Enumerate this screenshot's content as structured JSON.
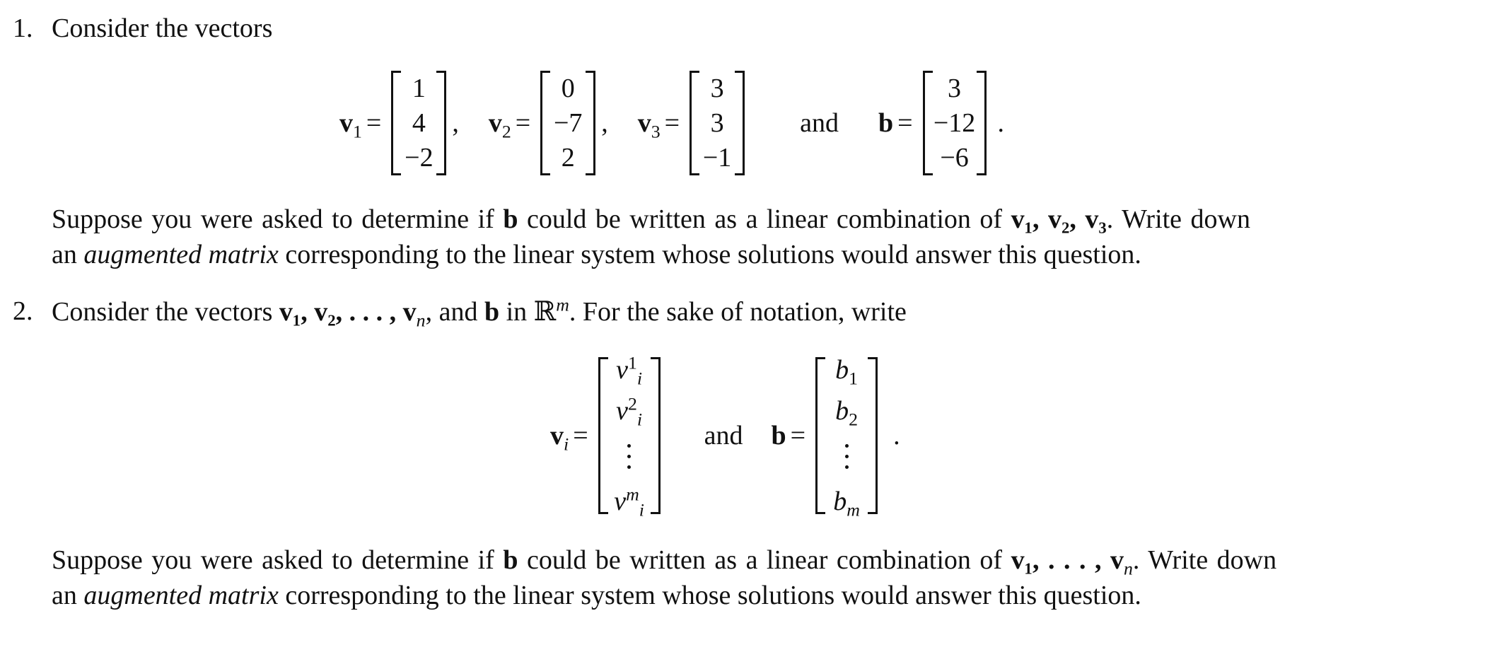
{
  "problem1": {
    "number": "1.",
    "intro": "Consider the vectors",
    "vectors": [
      {
        "name": "v",
        "sub": "1",
        "entries": [
          "1",
          "4",
          "−2"
        ],
        "trail": ","
      },
      {
        "name": "v",
        "sub": "2",
        "entries": [
          "0",
          "−7",
          "2"
        ],
        "trail": ","
      },
      {
        "name": "v",
        "sub": "3",
        "entries": [
          "3",
          "3",
          "−1"
        ],
        "trail": ""
      },
      {
        "name": "b",
        "sub": "",
        "entries": [
          "3",
          "−12",
          "−6"
        ],
        "trail": "."
      }
    ],
    "and": "and",
    "eq": "=",
    "para_line1_a": "Suppose you were asked to determine if ",
    "para_b": "b",
    "para_line1_b": " could be written as a linear combination of ",
    "para_vlist": "v₁, v₂, v₃",
    "para_line1_c": ". Write down",
    "para_line2_a": "an ",
    "para_line2_em": "augmented matrix",
    "para_line2_b": " corresponding to the linear system whose solutions would answer this question."
  },
  "problem2": {
    "number": "2.",
    "intro_a": "Consider the vectors ",
    "intro_vlist": "v₁, v₂, . . . , v",
    "intro_vsub": "n",
    "intro_b": ", and ",
    "intro_bvec": "b",
    "intro_c": " in ℝ",
    "intro_sup": "m",
    "intro_d": ". For the sake of notation, write",
    "vi_name": "v",
    "vi_sub": "i",
    "vi_entries": [
      {
        "base": "v",
        "sup": "1",
        "sub": "i"
      },
      {
        "base": "v",
        "sup": "2",
        "sub": "i"
      },
      {
        "base": "v",
        "sup": "m",
        "sub": "i"
      }
    ],
    "b_name": "b",
    "b_entries": [
      {
        "base": "b",
        "sub": "1"
      },
      {
        "base": "b",
        "sub": "2"
      },
      {
        "base": "b",
        "sub": "m"
      }
    ],
    "and": "and",
    "eq": "=",
    "trail": ".",
    "para_line1_a": "Suppose you were asked to determine if ",
    "para_b": "b",
    "para_line1_b": " could be written as a linear combination of ",
    "para_vlist": "v₁, . . . , v",
    "para_vsub": "n",
    "para_line1_c": ". Write down",
    "para_line2_a": "an ",
    "para_line2_em": "augmented matrix",
    "para_line2_b": " corresponding to the linear system whose solutions would answer this question."
  }
}
